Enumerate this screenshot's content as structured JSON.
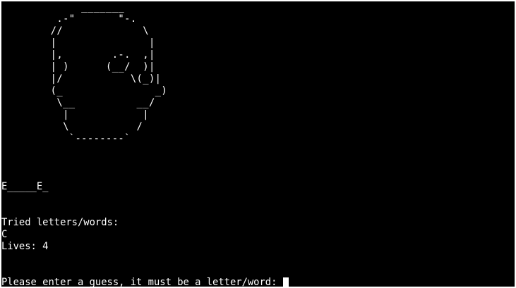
{
  "terminal": {
    "ascii_art": "             _______\n         .-\"       \"-.\n        //             \\\n        |               |\n        |,        .-.  ,|\n        | )      (__/  )|\n        |/           \\(_)|\n        (_               _)\n         \\__          __/\n          |            |\n          \\           /\n           `--------`",
    "word_display": "E_____E_",
    "tried_label": "Tried letters/words:",
    "tried_letters": "C",
    "lives_text": "Lives: 4",
    "prompt": "Please enter a guess, it must be a letter/word: "
  },
  "colors": {
    "background": "#000000",
    "foreground": "#ffffff"
  }
}
